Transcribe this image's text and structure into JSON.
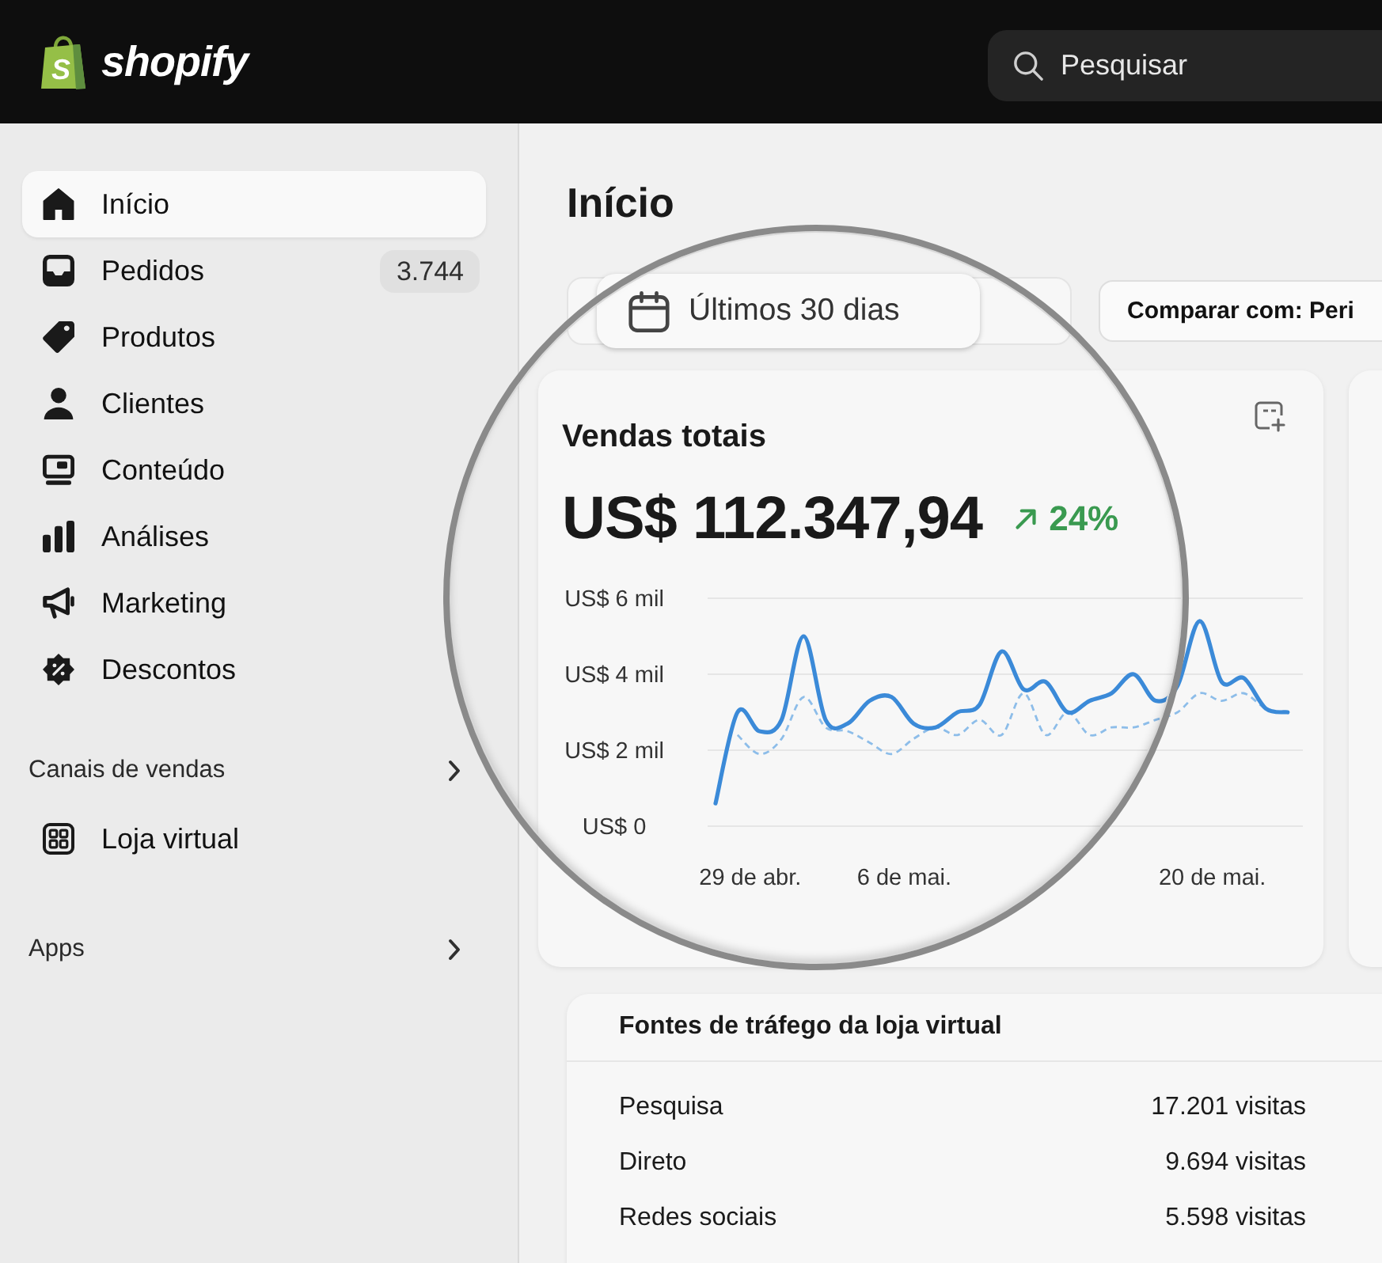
{
  "header": {
    "logo": {
      "mark": "S",
      "wordmark": "shopify"
    },
    "search": {
      "placeholder": "Pesquisar"
    }
  },
  "sidebar": {
    "nav": [
      {
        "label": "Início",
        "selected": true
      },
      {
        "label": "Pedidos",
        "selected": false,
        "badge": "3.744"
      },
      {
        "label": "Produtos",
        "selected": false
      },
      {
        "label": "Clientes",
        "selected": false
      },
      {
        "label": "Conteúdo",
        "selected": false
      },
      {
        "label": "Análises",
        "selected": false
      },
      {
        "label": "Marketing",
        "selected": false
      },
      {
        "label": "Descontos",
        "selected": false
      }
    ],
    "sections": [
      {
        "title": "Canais de vendas",
        "items": [
          {
            "label": "Loja virtual",
            "selected": false
          }
        ]
      },
      {
        "title": "Apps"
      }
    ]
  },
  "page": {
    "title": "Início",
    "date_range": "Últimos 30 dias",
    "compare": "Comparar com: Peri"
  },
  "sales_card": {
    "title": "Vendas totais",
    "total": "US$ 112.347,94",
    "change": "24%",
    "chart": {
      "y_labels": [
        "US$ 6 mil",
        "US$ 4 mil",
        "US$ 2 mil",
        "US$ 0"
      ],
      "x_labels": [
        "29 de abr.",
        "6 de mai.",
        "20 de mai."
      ]
    }
  },
  "traffic_card": {
    "title": "Fontes de tráfego da loja virtual",
    "rows": [
      {
        "source": "Pesquisa",
        "visits": "17.201 visitas"
      },
      {
        "source": "Direto",
        "visits": "9.694 visitas"
      },
      {
        "source": "Redes sociais",
        "visits": "5.598 visitas"
      }
    ]
  }
}
